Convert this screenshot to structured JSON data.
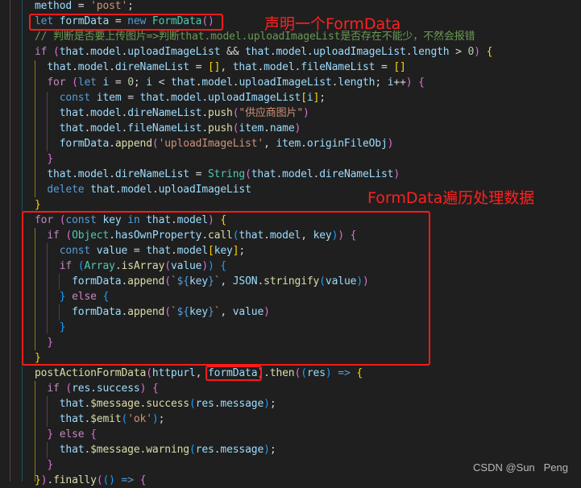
{
  "editor": {
    "theme_colors": {
      "background": "#1f1f1f",
      "keyword": "#569cd6",
      "control": "#c586c0",
      "variable": "#9cdcfe",
      "function": "#dcdcaa",
      "class": "#4ec9b0",
      "string": "#ce9178",
      "number": "#b5cea8",
      "comment": "#6a9955",
      "annotation": "#ff1a1a"
    },
    "lines": [
      [
        [
          "var",
          "method"
        ],
        [
          "op",
          " = "
        ],
        [
          "str",
          "'post'"
        ],
        [
          "op",
          ";"
        ]
      ],
      [
        [
          "kw",
          "let"
        ],
        [
          "op",
          " "
        ],
        [
          "var",
          "formData"
        ],
        [
          "op",
          " = "
        ],
        [
          "kw",
          "new"
        ],
        [
          "op",
          " "
        ],
        [
          "cls",
          "FormData"
        ],
        [
          "b2",
          "()"
        ]
      ],
      [
        [
          "cmt",
          "// 判断是否要上传图片=>判断that.model.uploadImageList是否存在不能少，不然会报错"
        ]
      ],
      [
        [
          "ctl",
          "if"
        ],
        [
          "op",
          " "
        ],
        [
          "b2",
          "("
        ],
        [
          "var",
          "that"
        ],
        [
          "op",
          "."
        ],
        [
          "var",
          "model"
        ],
        [
          "op",
          "."
        ],
        [
          "var",
          "uploadImageList"
        ],
        [
          "op",
          " && "
        ],
        [
          "var",
          "that"
        ],
        [
          "op",
          "."
        ],
        [
          "var",
          "model"
        ],
        [
          "op",
          "."
        ],
        [
          "var",
          "uploadImageList"
        ],
        [
          "op",
          "."
        ],
        [
          "var",
          "length"
        ],
        [
          "op",
          " > "
        ],
        [
          "num",
          "0"
        ],
        [
          "b2",
          ")"
        ],
        [
          "op",
          " "
        ],
        [
          "b1",
          "{"
        ]
      ],
      [
        [
          "op",
          "  "
        ],
        [
          "var",
          "that"
        ],
        [
          "op",
          "."
        ],
        [
          "var",
          "model"
        ],
        [
          "op",
          "."
        ],
        [
          "var",
          "direNameList"
        ],
        [
          "op",
          " = "
        ],
        [
          "b1",
          "[]"
        ],
        [
          "op",
          ", "
        ],
        [
          "var",
          "that"
        ],
        [
          "op",
          "."
        ],
        [
          "var",
          "model"
        ],
        [
          "op",
          "."
        ],
        [
          "var",
          "fileNameList"
        ],
        [
          "op",
          " = "
        ],
        [
          "b1",
          "[]"
        ]
      ],
      [
        [
          "op",
          "  "
        ],
        [
          "ctl",
          "for"
        ],
        [
          "op",
          " "
        ],
        [
          "b2",
          "("
        ],
        [
          "kw",
          "let"
        ],
        [
          "op",
          " "
        ],
        [
          "var",
          "i"
        ],
        [
          "op",
          " = "
        ],
        [
          "num",
          "0"
        ],
        [
          "op",
          "; "
        ],
        [
          "var",
          "i"
        ],
        [
          "op",
          " < "
        ],
        [
          "var",
          "that"
        ],
        [
          "op",
          "."
        ],
        [
          "var",
          "model"
        ],
        [
          "op",
          "."
        ],
        [
          "var",
          "uploadImageList"
        ],
        [
          "op",
          "."
        ],
        [
          "var",
          "length"
        ],
        [
          "op",
          "; "
        ],
        [
          "var",
          "i"
        ],
        [
          "op",
          "++"
        ],
        [
          "b2",
          ")"
        ],
        [
          "op",
          " "
        ],
        [
          "b2",
          "{"
        ]
      ],
      [
        [
          "op",
          "    "
        ],
        [
          "kw",
          "const"
        ],
        [
          "op",
          " "
        ],
        [
          "var",
          "item"
        ],
        [
          "op",
          " = "
        ],
        [
          "var",
          "that"
        ],
        [
          "op",
          "."
        ],
        [
          "var",
          "model"
        ],
        [
          "op",
          "."
        ],
        [
          "var",
          "uploadImageList"
        ],
        [
          "b1",
          "["
        ],
        [
          "var",
          "i"
        ],
        [
          "b1",
          "]"
        ],
        [
          "op",
          ";"
        ]
      ],
      [
        [
          "op",
          "    "
        ],
        [
          "var",
          "that"
        ],
        [
          "op",
          "."
        ],
        [
          "var",
          "model"
        ],
        [
          "op",
          "."
        ],
        [
          "var",
          "direNameList"
        ],
        [
          "op",
          "."
        ],
        [
          "fn",
          "push"
        ],
        [
          "b2",
          "("
        ],
        [
          "str",
          "\"供应商图片\""
        ],
        [
          "b2",
          ")"
        ]
      ],
      [
        [
          "op",
          "    "
        ],
        [
          "var",
          "that"
        ],
        [
          "op",
          "."
        ],
        [
          "var",
          "model"
        ],
        [
          "op",
          "."
        ],
        [
          "var",
          "fileNameList"
        ],
        [
          "op",
          "."
        ],
        [
          "fn",
          "push"
        ],
        [
          "b2",
          "("
        ],
        [
          "var",
          "item"
        ],
        [
          "op",
          "."
        ],
        [
          "var",
          "name"
        ],
        [
          "b2",
          ")"
        ]
      ],
      [
        [
          "op",
          "    "
        ],
        [
          "var",
          "formData"
        ],
        [
          "op",
          "."
        ],
        [
          "fn",
          "append"
        ],
        [
          "b2",
          "("
        ],
        [
          "str",
          "'uploadImageList'"
        ],
        [
          "op",
          ", "
        ],
        [
          "var",
          "item"
        ],
        [
          "op",
          "."
        ],
        [
          "var",
          "originFileObj"
        ],
        [
          "b2",
          ")"
        ]
      ],
      [
        [
          "op",
          "  "
        ],
        [
          "b2",
          "}"
        ]
      ],
      [
        [
          "op",
          "  "
        ],
        [
          "var",
          "that"
        ],
        [
          "op",
          "."
        ],
        [
          "var",
          "model"
        ],
        [
          "op",
          "."
        ],
        [
          "var",
          "direNameList"
        ],
        [
          "op",
          " = "
        ],
        [
          "cls",
          "String"
        ],
        [
          "b2",
          "("
        ],
        [
          "var",
          "that"
        ],
        [
          "op",
          "."
        ],
        [
          "var",
          "model"
        ],
        [
          "op",
          "."
        ],
        [
          "var",
          "direNameList"
        ],
        [
          "b2",
          ")"
        ]
      ],
      [
        [
          "op",
          "  "
        ],
        [
          "kw",
          "delete"
        ],
        [
          "op",
          " "
        ],
        [
          "var",
          "that"
        ],
        [
          "op",
          "."
        ],
        [
          "var",
          "model"
        ],
        [
          "op",
          "."
        ],
        [
          "var",
          "uploadImageList"
        ]
      ],
      [
        [
          "b1",
          "}"
        ]
      ],
      [
        [
          "ctl",
          "for"
        ],
        [
          "op",
          " "
        ],
        [
          "b2",
          "("
        ],
        [
          "kw",
          "const"
        ],
        [
          "op",
          " "
        ],
        [
          "var",
          "key"
        ],
        [
          "op",
          " "
        ],
        [
          "kw",
          "in"
        ],
        [
          "op",
          " "
        ],
        [
          "var",
          "that"
        ],
        [
          "op",
          "."
        ],
        [
          "var",
          "model"
        ],
        [
          "b2",
          ")"
        ],
        [
          "op",
          " "
        ],
        [
          "b1",
          "{"
        ]
      ],
      [
        [
          "op",
          "  "
        ],
        [
          "ctl",
          "if"
        ],
        [
          "op",
          " "
        ],
        [
          "b2",
          "("
        ],
        [
          "cls",
          "Object"
        ],
        [
          "op",
          "."
        ],
        [
          "var",
          "hasOwnProperty"
        ],
        [
          "op",
          "."
        ],
        [
          "fn",
          "call"
        ],
        [
          "b3",
          "("
        ],
        [
          "var",
          "that"
        ],
        [
          "op",
          "."
        ],
        [
          "var",
          "model"
        ],
        [
          "op",
          ", "
        ],
        [
          "var",
          "key"
        ],
        [
          "b3",
          ")"
        ],
        [
          "b2",
          ")"
        ],
        [
          "op",
          " "
        ],
        [
          "b2",
          "{"
        ]
      ],
      [
        [
          "op",
          "    "
        ],
        [
          "kw",
          "const"
        ],
        [
          "op",
          " "
        ],
        [
          "var",
          "value"
        ],
        [
          "op",
          " = "
        ],
        [
          "var",
          "that"
        ],
        [
          "op",
          "."
        ],
        [
          "var",
          "model"
        ],
        [
          "b1",
          "["
        ],
        [
          "var",
          "key"
        ],
        [
          "b1",
          "]"
        ],
        [
          "op",
          ";"
        ]
      ],
      [
        [
          "op",
          "    "
        ],
        [
          "ctl",
          "if"
        ],
        [
          "op",
          " "
        ],
        [
          "b3",
          "("
        ],
        [
          "cls",
          "Array"
        ],
        [
          "op",
          "."
        ],
        [
          "fn",
          "isArray"
        ],
        [
          "b2",
          "("
        ],
        [
          "var",
          "value"
        ],
        [
          "b2",
          ")"
        ],
        [
          "b3",
          ")"
        ],
        [
          "op",
          " "
        ],
        [
          "b3",
          "{"
        ]
      ],
      [
        [
          "op",
          "      "
        ],
        [
          "var",
          "formData"
        ],
        [
          "op",
          "."
        ],
        [
          "fn",
          "append"
        ],
        [
          "b2",
          "("
        ],
        [
          "str",
          "`"
        ],
        [
          "kw",
          "${"
        ],
        [
          "var",
          "key"
        ],
        [
          "kw",
          "}"
        ],
        [
          "str",
          "`"
        ],
        [
          "op",
          ", "
        ],
        [
          "var",
          "JSON"
        ],
        [
          "op",
          "."
        ],
        [
          "fn",
          "stringify"
        ],
        [
          "b3",
          "("
        ],
        [
          "var",
          "value"
        ],
        [
          "b3",
          ")"
        ],
        [
          "b2",
          ")"
        ]
      ],
      [
        [
          "op",
          "    "
        ],
        [
          "b3",
          "}"
        ],
        [
          "op",
          " "
        ],
        [
          "ctl",
          "else"
        ],
        [
          "op",
          " "
        ],
        [
          "b3",
          "{"
        ]
      ],
      [
        [
          "op",
          "      "
        ],
        [
          "var",
          "formData"
        ],
        [
          "op",
          "."
        ],
        [
          "fn",
          "append"
        ],
        [
          "b2",
          "("
        ],
        [
          "str",
          "`"
        ],
        [
          "kw",
          "${"
        ],
        [
          "var",
          "key"
        ],
        [
          "kw",
          "}"
        ],
        [
          "str",
          "`"
        ],
        [
          "op",
          ", "
        ],
        [
          "var",
          "value"
        ],
        [
          "b2",
          ")"
        ]
      ],
      [
        [
          "op",
          "    "
        ],
        [
          "b3",
          "}"
        ]
      ],
      [
        [
          "op",
          "  "
        ],
        [
          "b2",
          "}"
        ]
      ],
      [
        [
          "b1",
          "}"
        ]
      ],
      [
        [
          "fn",
          "postActionFormData"
        ],
        [
          "b2",
          "("
        ],
        [
          "var",
          "httpurl"
        ],
        [
          "op",
          ", "
        ],
        [
          "var",
          "formData"
        ],
        [
          "b2",
          ")"
        ],
        [
          "op",
          "."
        ],
        [
          "fn",
          "then"
        ],
        [
          "b2",
          "("
        ],
        [
          "b3",
          "("
        ],
        [
          "var",
          "res"
        ],
        [
          "b3",
          ")"
        ],
        [
          "op",
          " "
        ],
        [
          "kw",
          "=>"
        ],
        [
          "op",
          " "
        ],
        [
          "b1",
          "{"
        ]
      ],
      [
        [
          "op",
          "  "
        ],
        [
          "ctl",
          "if"
        ],
        [
          "op",
          " "
        ],
        [
          "b2",
          "("
        ],
        [
          "var",
          "res"
        ],
        [
          "op",
          "."
        ],
        [
          "var",
          "success"
        ],
        [
          "b2",
          ")"
        ],
        [
          "op",
          " "
        ],
        [
          "b2",
          "{"
        ]
      ],
      [
        [
          "op",
          "    "
        ],
        [
          "var",
          "that"
        ],
        [
          "op",
          "."
        ],
        [
          "fn",
          "$message"
        ],
        [
          "op",
          "."
        ],
        [
          "fn",
          "success"
        ],
        [
          "b3",
          "("
        ],
        [
          "var",
          "res"
        ],
        [
          "op",
          "."
        ],
        [
          "var",
          "message"
        ],
        [
          "b3",
          ")"
        ],
        [
          "op",
          ";"
        ]
      ],
      [
        [
          "op",
          "    "
        ],
        [
          "var",
          "that"
        ],
        [
          "op",
          "."
        ],
        [
          "fn",
          "$emit"
        ],
        [
          "b3",
          "("
        ],
        [
          "str",
          "'ok'"
        ],
        [
          "b3",
          ")"
        ],
        [
          "op",
          ";"
        ]
      ],
      [
        [
          "op",
          "  "
        ],
        [
          "b2",
          "}"
        ],
        [
          "op",
          " "
        ],
        [
          "ctl",
          "else"
        ],
        [
          "op",
          " "
        ],
        [
          "b2",
          "{"
        ]
      ],
      [
        [
          "op",
          "    "
        ],
        [
          "var",
          "that"
        ],
        [
          "op",
          "."
        ],
        [
          "fn",
          "$message"
        ],
        [
          "op",
          "."
        ],
        [
          "fn",
          "warning"
        ],
        [
          "b3",
          "("
        ],
        [
          "var",
          "res"
        ],
        [
          "op",
          "."
        ],
        [
          "var",
          "message"
        ],
        [
          "b3",
          ")"
        ],
        [
          "op",
          ";"
        ]
      ],
      [
        [
          "op",
          "  "
        ],
        [
          "b2",
          "}"
        ]
      ],
      [
        [
          "b1",
          "}"
        ],
        [
          "b2",
          ")"
        ],
        [
          "op",
          "."
        ],
        [
          "fn",
          "finally"
        ],
        [
          "b2",
          "("
        ],
        [
          "b3",
          "()"
        ],
        [
          "op",
          " "
        ],
        [
          "kw",
          "=>"
        ],
        [
          "op",
          " "
        ],
        [
          "b2",
          "{"
        ]
      ]
    ]
  },
  "annotations": {
    "declare_label": "声明一个FormData",
    "loop_label": "FormData遍历处理数据"
  },
  "watermark": "CSDN @Sun   Peng"
}
